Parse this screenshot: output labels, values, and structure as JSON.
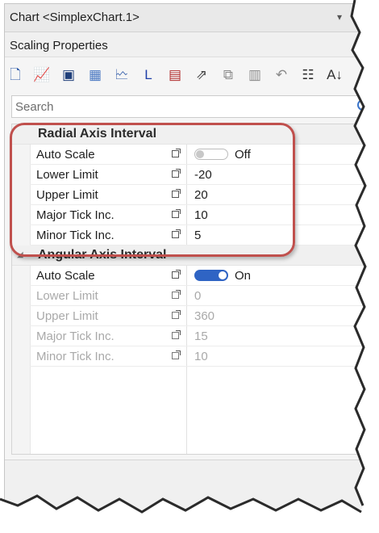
{
  "panel": {
    "title": "Chart <SimplexChart.1>",
    "title_controls": [
      "▾",
      "ᵽ"
    ],
    "section_title": "Scaling Properties"
  },
  "toolbar": {
    "icons": [
      {
        "name": "new-item-icon",
        "glyph": "🗋",
        "color": "#2f5aa8"
      },
      {
        "name": "chart-properties-icon",
        "glyph": "📈",
        "color": "#c0392b"
      },
      {
        "name": "plot-area-icon",
        "glyph": "▣",
        "color": "#1f3f7a"
      },
      {
        "name": "grid-lines-icon",
        "glyph": "▦",
        "color": "#4a78c2"
      },
      {
        "name": "chart-settings-icon",
        "glyph": "🗠",
        "color": "#2f5aa8"
      },
      {
        "name": "legend-icon",
        "glyph": "L",
        "color": "#1f3fa8"
      },
      {
        "name": "data-table-icon",
        "glyph": "▤",
        "color": "#b02a2a"
      },
      {
        "name": "export-icon",
        "glyph": "⇗",
        "color": "#444444"
      },
      {
        "name": "link-icon",
        "glyph": "⧉",
        "color": "#8a8a8a"
      },
      {
        "name": "table-view-icon",
        "glyph": "▥",
        "color": "#8a8a8a"
      },
      {
        "name": "undo-icon",
        "glyph": "↶",
        "color": "#8a8a8a"
      },
      {
        "name": "categorized-icon",
        "glyph": "☷",
        "color": "#333333"
      },
      {
        "name": "alphabetical-icon",
        "glyph": "A↓",
        "color": "#333333"
      }
    ]
  },
  "search": {
    "placeholder": "Search"
  },
  "categories": [
    {
      "label": "Radial Axis Interval",
      "expand_glyph": "◢",
      "properties": [
        {
          "name": "Auto Scale",
          "type": "toggle",
          "state": "off",
          "value": "Off",
          "enabled": true
        },
        {
          "name": "Lower Limit",
          "type": "text",
          "value": "-20",
          "enabled": true
        },
        {
          "name": "Upper Limit",
          "type": "text",
          "value": "20",
          "enabled": true
        },
        {
          "name": "Major Tick Inc.",
          "type": "text",
          "value": "10",
          "enabled": true
        },
        {
          "name": "Minor Tick Inc.",
          "type": "text",
          "value": "5",
          "enabled": true
        }
      ]
    },
    {
      "label": "Angular Axis Interval",
      "expand_glyph": "◢",
      "properties": [
        {
          "name": "Auto Scale",
          "type": "toggle",
          "state": "on",
          "value": "On",
          "enabled": true
        },
        {
          "name": "Lower Limit",
          "type": "text",
          "value": "0",
          "enabled": false
        },
        {
          "name": "Upper Limit",
          "type": "text",
          "value": "360",
          "enabled": false
        },
        {
          "name": "Major Tick Inc.",
          "type": "text",
          "value": "15",
          "enabled": false
        },
        {
          "name": "Minor Tick Inc.",
          "type": "text",
          "value": "10",
          "enabled": false
        }
      ]
    }
  ],
  "colors": {
    "accent_toggle_on": "#2f64c4",
    "highlight_ring": "#c0504d",
    "disabled_text": "#a9a9a9"
  }
}
